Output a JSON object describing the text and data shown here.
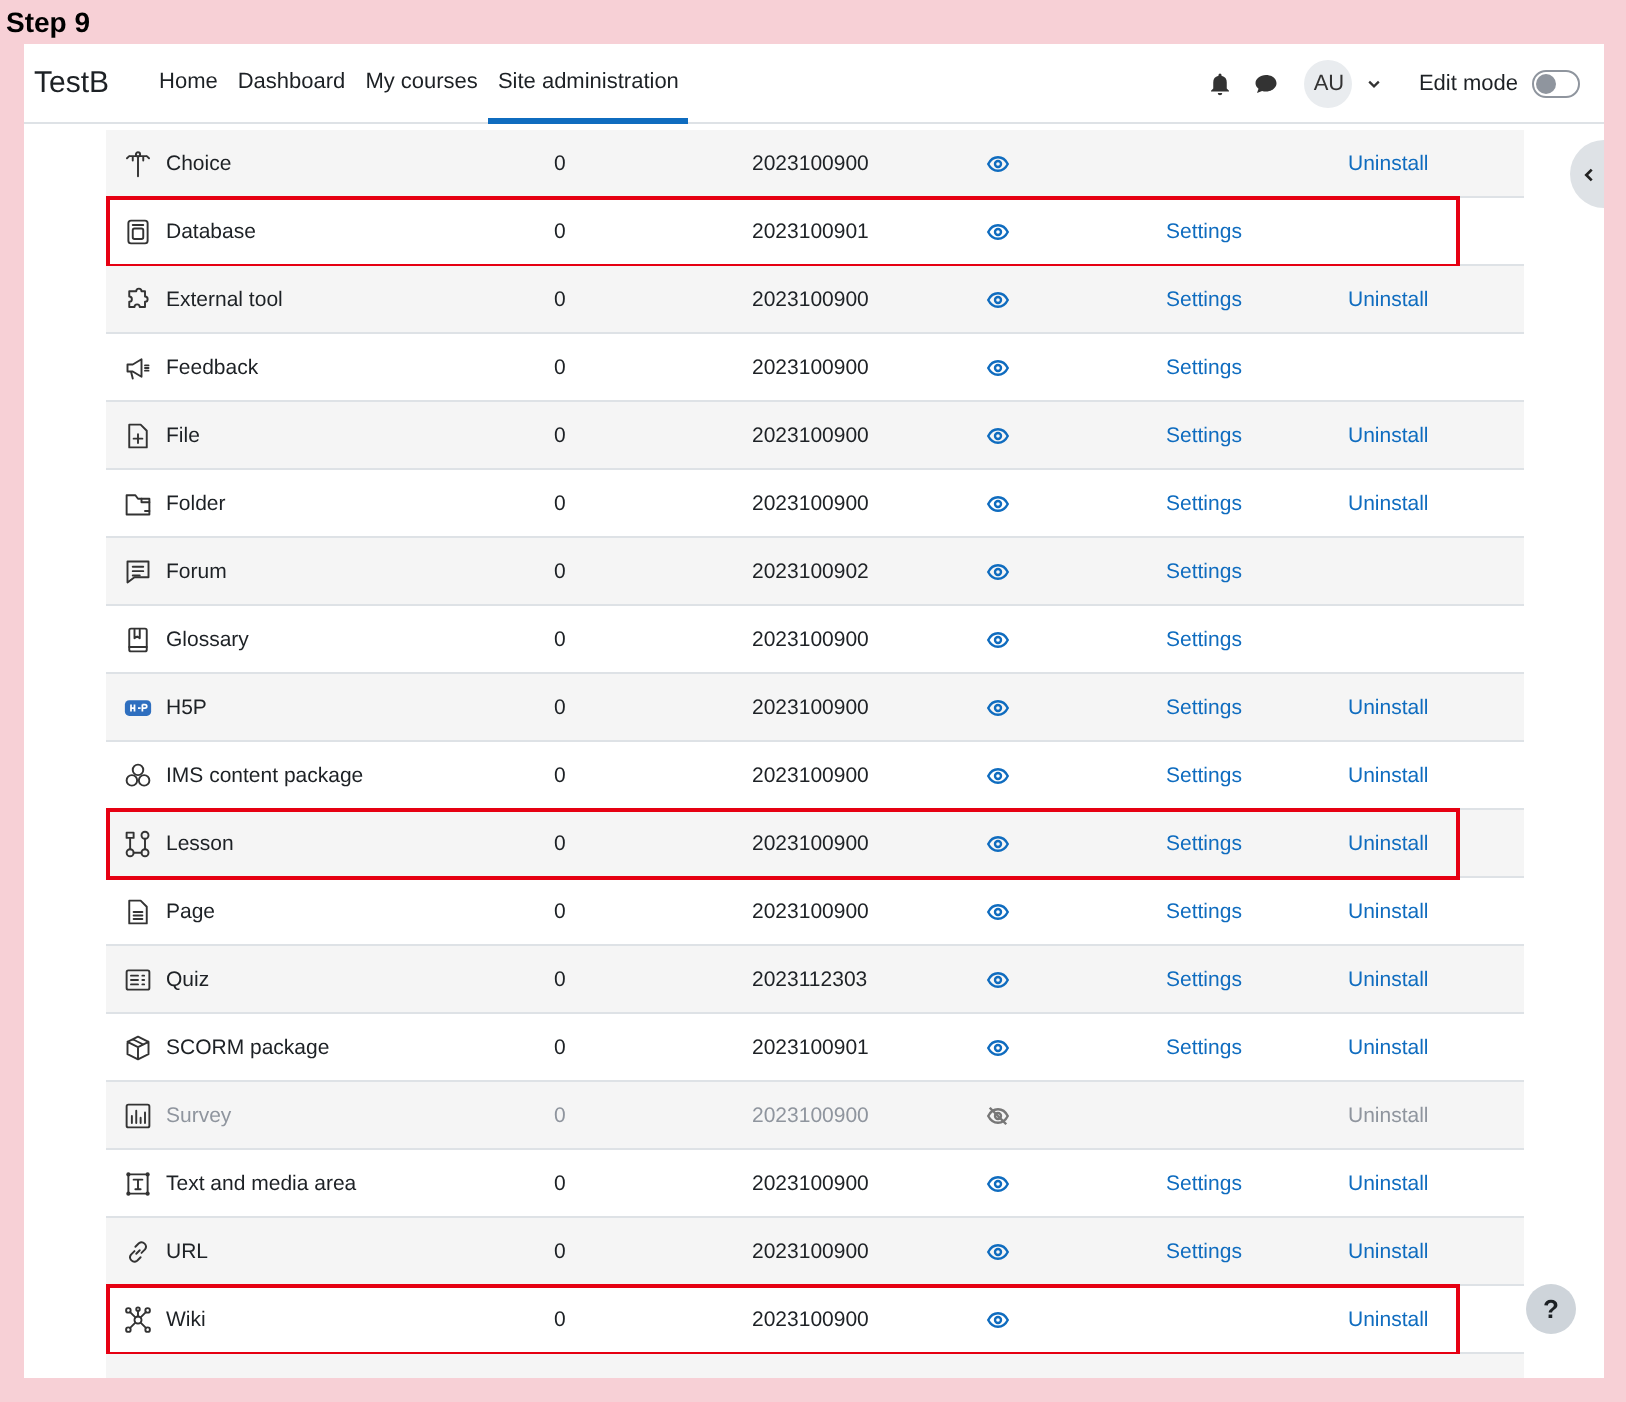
{
  "step_label": "Step 9",
  "navbar": {
    "brand": "TestB",
    "links": [
      {
        "label": "Home",
        "selected": false
      },
      {
        "label": "Dashboard",
        "selected": false
      },
      {
        "label": "My courses",
        "selected": false
      },
      {
        "label": "Site administration",
        "selected": true
      }
    ],
    "avatar": "AU",
    "edit_mode": {
      "label": "Edit mode",
      "on": false
    }
  },
  "plugins": [
    {
      "name": "Choice",
      "count": "0",
      "version": "2023100900",
      "visible": true,
      "uninstall": "Uninstall",
      "highlighted": false
    },
    {
      "name": "Database",
      "count": "0",
      "version": "2023100901",
      "visible": true,
      "settings": "Settings",
      "highlighted": true
    },
    {
      "name": "External tool",
      "count": "0",
      "version": "2023100900",
      "visible": true,
      "settings": "Settings",
      "uninstall": "Uninstall",
      "highlighted": false
    },
    {
      "name": "Feedback",
      "count": "0",
      "version": "2023100900",
      "visible": true,
      "settings": "Settings",
      "highlighted": false
    },
    {
      "name": "File",
      "count": "0",
      "version": "2023100900",
      "visible": true,
      "settings": "Settings",
      "uninstall": "Uninstall",
      "highlighted": false
    },
    {
      "name": "Folder",
      "count": "0",
      "version": "2023100900",
      "visible": true,
      "settings": "Settings",
      "uninstall": "Uninstall",
      "highlighted": false
    },
    {
      "name": "Forum",
      "count": "0",
      "version": "2023100902",
      "visible": true,
      "settings": "Settings",
      "highlighted": false
    },
    {
      "name": "Glossary",
      "count": "0",
      "version": "2023100900",
      "visible": true,
      "settings": "Settings",
      "highlighted": false
    },
    {
      "name": "H5P",
      "count": "0",
      "version": "2023100900",
      "visible": true,
      "settings": "Settings",
      "uninstall": "Uninstall",
      "highlighted": false
    },
    {
      "name": "IMS content package",
      "count": "0",
      "version": "2023100900",
      "visible": true,
      "settings": "Settings",
      "uninstall": "Uninstall",
      "highlighted": false
    },
    {
      "name": "Lesson",
      "count": "0",
      "version": "2023100900",
      "visible": true,
      "settings": "Settings",
      "uninstall": "Uninstall",
      "highlighted": true
    },
    {
      "name": "Page",
      "count": "0",
      "version": "2023100900",
      "visible": true,
      "settings": "Settings",
      "uninstall": "Uninstall",
      "highlighted": false
    },
    {
      "name": "Quiz",
      "count": "0",
      "version": "2023112303",
      "visible": true,
      "settings": "Settings",
      "uninstall": "Uninstall",
      "highlighted": false
    },
    {
      "name": "SCORM package",
      "count": "0",
      "version": "2023100901",
      "visible": true,
      "settings": "Settings",
      "uninstall": "Uninstall",
      "highlighted": false
    },
    {
      "name": "Survey",
      "count": "0",
      "version": "2023100900",
      "visible": false,
      "uninstall": "Uninstall",
      "highlighted": false
    },
    {
      "name": "Text and media area",
      "count": "0",
      "version": "2023100900",
      "visible": true,
      "settings": "Settings",
      "uninstall": "Uninstall",
      "highlighted": false
    },
    {
      "name": "URL",
      "count": "0",
      "version": "2023100900",
      "visible": true,
      "settings": "Settings",
      "uninstall": "Uninstall",
      "highlighted": false
    },
    {
      "name": "Wiki",
      "count": "0",
      "version": "2023100900",
      "visible": true,
      "uninstall": "Uninstall",
      "highlighted": true
    }
  ],
  "help_button": "?"
}
